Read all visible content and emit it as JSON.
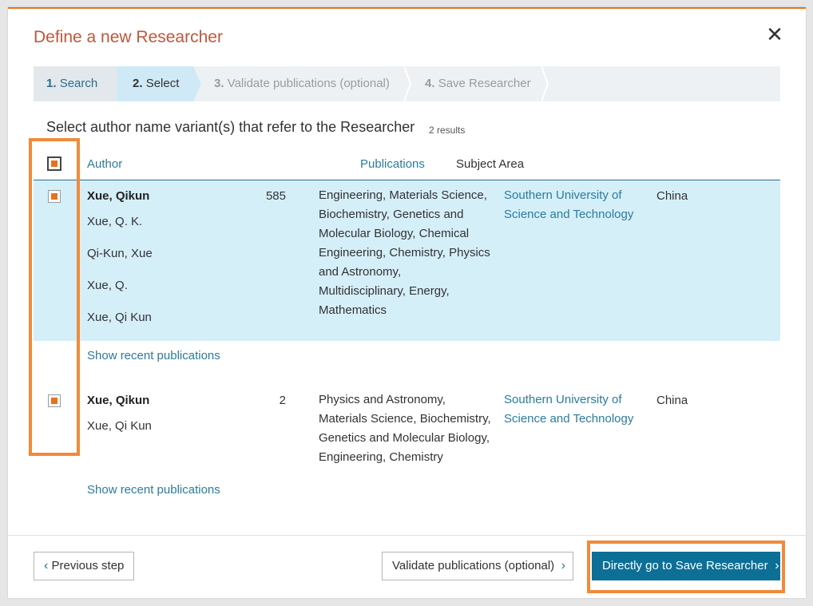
{
  "dialog": {
    "title": "Define a new Researcher",
    "close_glyph": "✕"
  },
  "steps": [
    {
      "num": "1.",
      "label": "Search"
    },
    {
      "num": "2.",
      "label": "Select"
    },
    {
      "num": "3.",
      "label": "Validate publications (optional)"
    },
    {
      "num": "4.",
      "label": "Save Researcher"
    }
  ],
  "selection": {
    "heading": "Select author name variant(s) that refer to the Researcher",
    "result_count": "2 results"
  },
  "table": {
    "columns": {
      "author": "Author",
      "publications": "Publications",
      "subject_area": "Subject Area"
    },
    "rows": [
      {
        "name": "Xue, Qikun",
        "variants": [
          "Xue, Q. K.",
          "Qi-Kun, Xue",
          "Xue, Q.",
          "Xue, Qi Kun"
        ],
        "publications": "585",
        "subject_lines": [
          "Engineering, Materials Science,",
          "Biochemistry, Genetics and",
          "Molecular Biology, Chemical",
          "Engineering, Chemistry, Physics",
          "and Astronomy,",
          "Multidisciplinary, Energy,",
          "Mathematics"
        ],
        "affiliation_lines": [
          "Southern University of",
          "Science and Technology"
        ],
        "country": "China",
        "show_link": "Show recent publications"
      },
      {
        "name": "Xue, Qikun",
        "variants": [
          "Xue, Qi Kun"
        ],
        "publications": "2",
        "subject_lines": [
          "Physics and Astronomy,",
          "Materials Science, Biochemistry,",
          "Genetics and Molecular Biology,",
          "Engineering, Chemistry"
        ],
        "affiliation_lines": [
          "Southern University of",
          "Science and Technology"
        ],
        "country": "China",
        "show_link": "Show recent publications"
      }
    ]
  },
  "footer": {
    "prev_label": "Previous step",
    "validate_label": "Validate publications (optional)",
    "save_label": "Directly go to Save Researcher"
  },
  "colors": {
    "accent": "#e9711c",
    "title": "#c0573a",
    "link": "#2b7b9d",
    "primary_button": "#0c6f96",
    "selected_row": "#d5eff9"
  }
}
